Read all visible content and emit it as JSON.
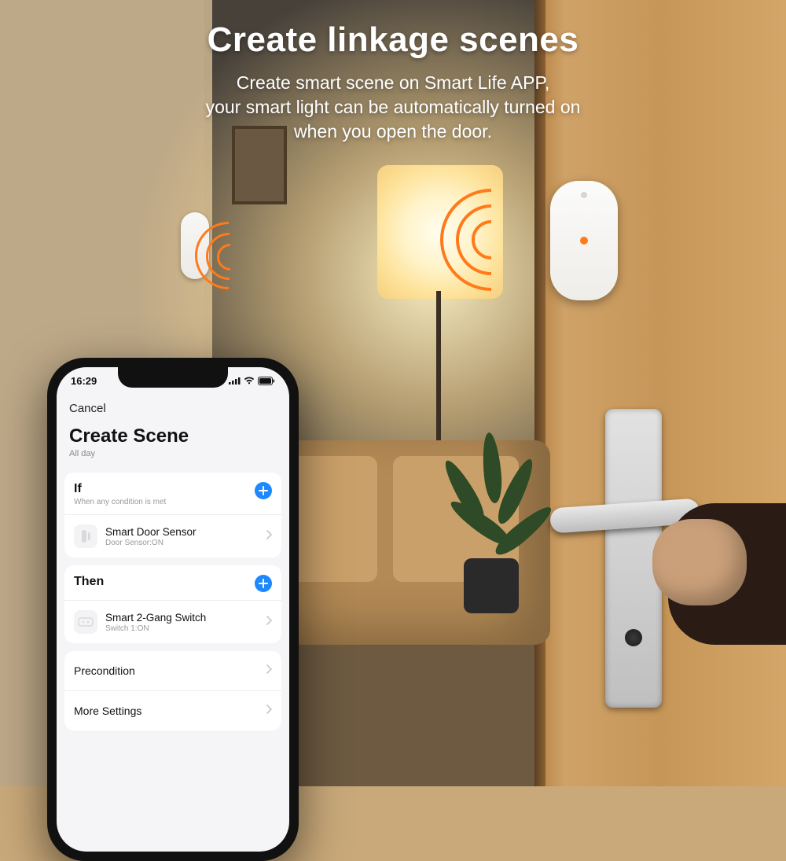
{
  "hero": {
    "title": "Create linkage scenes",
    "subtitle": "Create smart scene on Smart Life APP,\nyour smart light can be automatically turned on\nwhen you open the door."
  },
  "phone": {
    "status": {
      "time": "16:29"
    },
    "nav": {
      "cancel": "Cancel"
    },
    "page": {
      "title": "Create Scene",
      "subtitle": "All day"
    },
    "if_section": {
      "title": "If",
      "subtitle": "When any condition is met",
      "item": {
        "title": "Smart Door Sensor",
        "subtitle": "Door Sensor:ON"
      }
    },
    "then_section": {
      "title": "Then",
      "item": {
        "title": "Smart 2-Gang Switch",
        "subtitle": "Switch 1:ON"
      }
    },
    "rows": {
      "precondition": "Precondition",
      "more": "More Settings"
    }
  },
  "colors": {
    "accent": "#1e88ff",
    "signal": "#ff7a1a"
  }
}
